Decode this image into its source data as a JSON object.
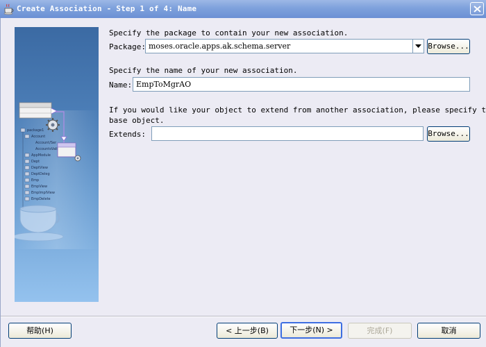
{
  "window": {
    "title": "Create Association - Step 1 of 4: Name"
  },
  "package_section": {
    "instruction": "Specify the package to contain your new association.",
    "label": "Package:",
    "value": "moses.oracle.apps.ak.schema.server",
    "browse_label": "Browse..."
  },
  "name_section": {
    "instruction": "Specify the name of your new association.",
    "label": "Name:",
    "value": "EmpToMgrAO"
  },
  "extends_section": {
    "instruction_line1": "If you would like your object to extend from another association, please specify the",
    "instruction_line2": "base object.",
    "label": "Extends:",
    "value": "",
    "browse_label": "Browse..."
  },
  "illustration": {
    "tree_items": [
      "package1",
      "Account",
      "Account/Ser",
      "AccountsValid",
      "AppModule",
      "Dept",
      "DeptView",
      "DeptDeleg",
      "Emp",
      "EmpView",
      "EmpImplView",
      "EmpDelete"
    ]
  },
  "footer": {
    "help_label": "帮助(H)",
    "back_label": "< 上一步(B)",
    "next_label": "下一步(N) >",
    "finish_label": "完成(F)",
    "cancel_label": "取消"
  }
}
